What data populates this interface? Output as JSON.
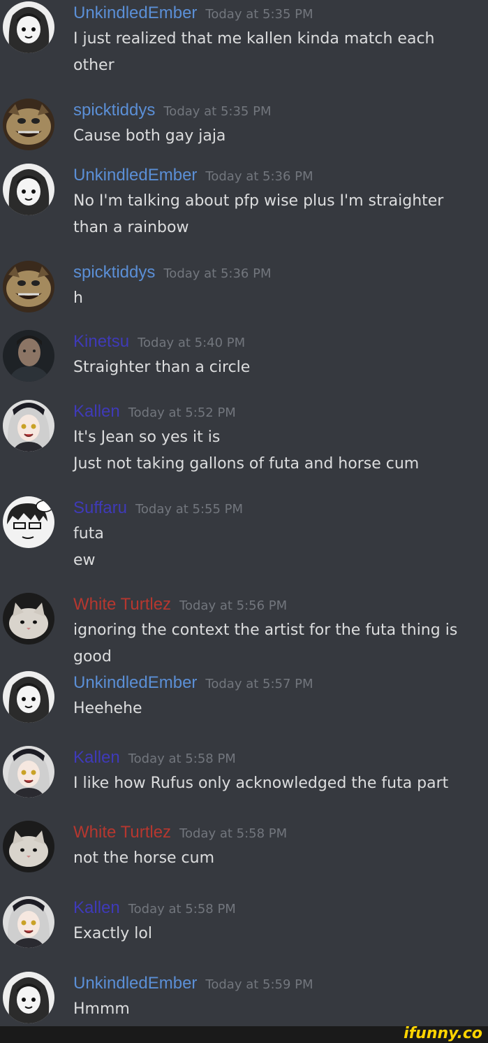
{
  "messages": [
    {
      "author": "UnkindledEmber",
      "avatar": "anime-girl-bw",
      "color": "#5b8fd6",
      "time": "Today at 5:35 PM",
      "lines": [
        "I just realized that me kallen kinda match each",
        "other"
      ]
    },
    {
      "author": "spicktiddys",
      "avatar": "troll-face",
      "color": "#5b8fd6",
      "time": "Today at 5:35 PM",
      "lines": [
        "Cause both gay jaja"
      ]
    },
    {
      "author": "UnkindledEmber",
      "avatar": "anime-girl-bw",
      "color": "#5b8fd6",
      "time": "Today at 5:36 PM",
      "lines": [
        "No I'm talking about pfp wise plus I'm straighter",
        "than a rainbow"
      ]
    },
    {
      "author": "spicktiddys",
      "avatar": "troll-face",
      "color": "#5b8fd6",
      "time": "Today at 5:36 PM",
      "lines": [
        "h"
      ]
    },
    {
      "author": "Kinetsu",
      "avatar": "man-portrait",
      "color": "#3f3ab8",
      "time": "Today at 5:40 PM",
      "lines": [
        "Straighter than a circle"
      ]
    },
    {
      "author": "Kallen",
      "avatar": "anime-girl-dark",
      "color": "#3f3ab8",
      "time": "Today at 5:52 PM",
      "lines": [
        "It's Jean so yes it is",
        "Just not taking gallons of futa and horse cum"
      ]
    },
    {
      "author": "Suffaru",
      "avatar": "manga-boy",
      "color": "#3f3ab8",
      "time": "Today at 5:55 PM",
      "lines": [
        "futa",
        "ew"
      ]
    },
    {
      "author": "White Turtlez",
      "avatar": "cat",
      "color": "#b6372f",
      "time": "Today at 5:56 PM",
      "lines": [
        "ignoring the context the artist for the futa thing is",
        "good"
      ]
    },
    {
      "author": "UnkindledEmber",
      "avatar": "anime-girl-bw",
      "color": "#5b8fd6",
      "time": "Today at 5:57 PM",
      "lines": [
        "Heehehe"
      ]
    },
    {
      "author": "Kallen",
      "avatar": "anime-girl-dark",
      "color": "#3f3ab8",
      "time": "Today at 5:58 PM",
      "lines": [
        "I like how Rufus only acknowledged the futa part"
      ]
    },
    {
      "author": "White Turtlez",
      "avatar": "cat",
      "color": "#b6372f",
      "time": "Today at 5:58 PM",
      "lines": [
        "not the horse cum"
      ]
    },
    {
      "author": "Kallen",
      "avatar": "anime-girl-dark",
      "color": "#3f3ab8",
      "time": "Today at 5:58 PM",
      "lines": [
        "Exactly lol"
      ]
    },
    {
      "author": "UnkindledEmber",
      "avatar": "anime-girl-bw",
      "color": "#5b8fd6",
      "time": "Today at 5:59 PM",
      "lines": [
        "Hmmm"
      ]
    }
  ],
  "watermark": "ifunny.co"
}
